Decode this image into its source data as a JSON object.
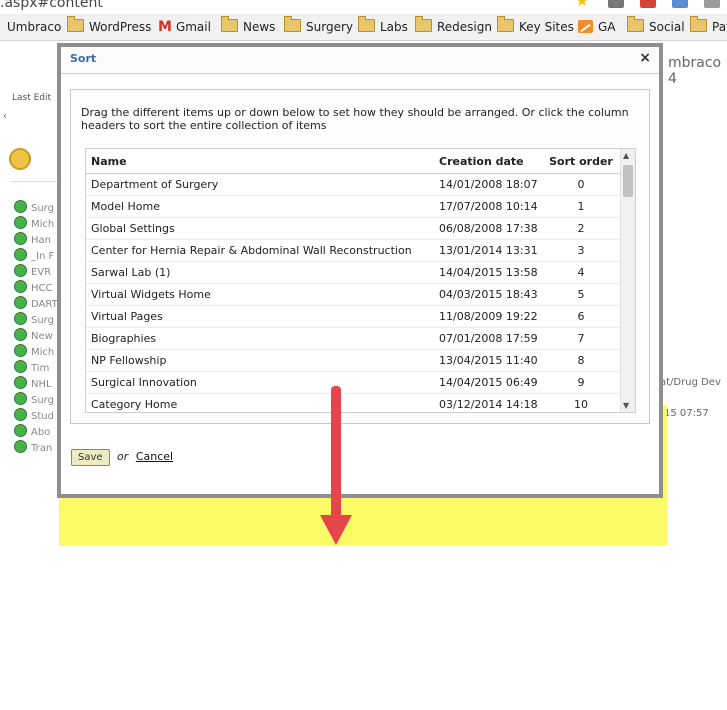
{
  "browser": {
    "url_fragment": ".aspx#content",
    "bookmarks": [
      "Umbraco",
      "WordPress",
      "Gmail",
      "News",
      "Surgery",
      "Labs",
      "Redesign",
      "Key Sites",
      "GA",
      "Social",
      "Pat"
    ]
  },
  "background": {
    "right_title": "mbraco 4",
    "last_edit": "Last Edit",
    "right_text_1": "at/Drug Dev",
    "right_text_2": "15 07:57",
    "tree_items": [
      "Surg",
      "Mich",
      "Han",
      "_In F",
      "EVR",
      "HCC",
      "DART",
      "Surg",
      "New",
      "Mich",
      "Tim",
      "NHL",
      "Surg",
      "Stud",
      "Abo",
      "Tran"
    ]
  },
  "dialog": {
    "title": "Sort",
    "close_label": "×",
    "instructions": "Drag the different items up or down below to set how they should be arranged. Or click the column headers to sort the entire collection of items",
    "columns": [
      "Name",
      "Creation date",
      "Sort order"
    ],
    "rows": [
      {
        "name": "Department of Surgery",
        "created": "14/01/2008 18:07",
        "order": "0"
      },
      {
        "name": "Model Home",
        "created": "17/07/2008 10:14",
        "order": "1"
      },
      {
        "name": "Global Settings",
        "created": "06/08/2008 17:38",
        "order": "2"
      },
      {
        "name": "Center for Hernia Repair & Abdominal Wall Reconstruction",
        "created": "13/01/2014 13:31",
        "order": "3"
      },
      {
        "name": "Sarwal Lab (1)",
        "created": "14/04/2015 13:58",
        "order": "4"
      },
      {
        "name": "Virtual Widgets Home",
        "created": "04/03/2015 18:43",
        "order": "5"
      },
      {
        "name": "Virtual Pages",
        "created": "11/08/2009 19:22",
        "order": "6"
      },
      {
        "name": "Biographies",
        "created": "07/01/2008 17:59",
        "order": "7"
      },
      {
        "name": "NP Fellowship",
        "created": "13/04/2015 11:40",
        "order": "8"
      },
      {
        "name": "Surgical Innovation",
        "created": "14/04/2015 06:49",
        "order": "9"
      },
      {
        "name": "Category Home",
        "created": "03/12/2014 14:18",
        "order": "10"
      }
    ],
    "save_label": "Save",
    "or_label": "or",
    "cancel_label": "Cancel"
  },
  "annotation": {
    "highlight_color": "#fbfb52",
    "arrow_color": "#e5464c"
  }
}
